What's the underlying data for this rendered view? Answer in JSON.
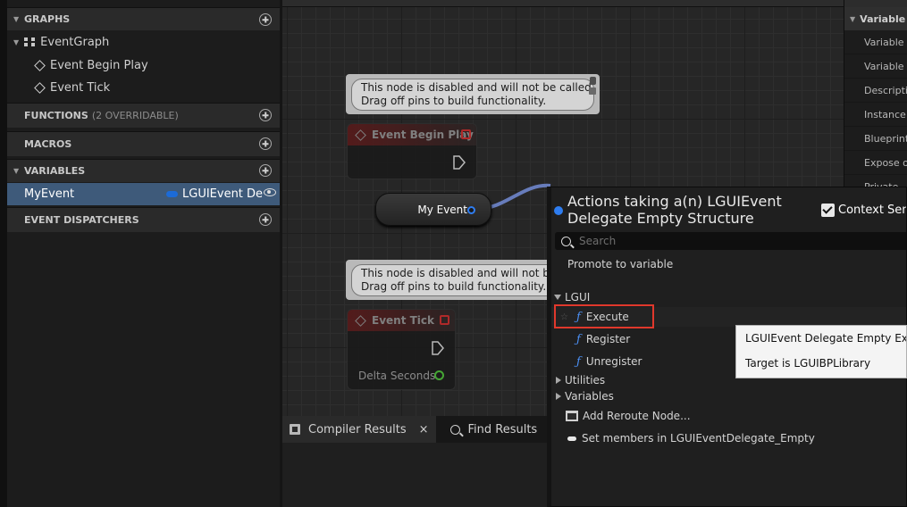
{
  "left_panel": {
    "graphs_header": "GRAPHS",
    "event_graph": "EventGraph",
    "event_begin_play": "Event Begin Play",
    "event_tick": "Event Tick",
    "functions_header": "FUNCTIONS",
    "functions_sub": "(2 OVERRIDABLE)",
    "macros_header": "MACROS",
    "variables_header": "VARIABLES",
    "variable": {
      "name": "MyEvent",
      "type": "LGUIEvent De"
    },
    "dispatchers_header": "EVENT DISPATCHERS"
  },
  "graph": {
    "comment_1": [
      "This node is disabled and will not be called.",
      "Drag off pins to build functionality."
    ],
    "comment_2": [
      "This node is disabled and will not be c",
      "Drag off pins to build functionality."
    ],
    "node_begin_play": "Event Begin Play",
    "node_tick": "Event Tick",
    "tick_pin": "Delta Seconds",
    "my_event_node": "My Event"
  },
  "details": {
    "section": "Variable",
    "rows": [
      "Variable N",
      "Variable T",
      "Descriptio",
      "Instance E",
      "Blueprint",
      "Expose or",
      "Private"
    ]
  },
  "bottom_tabs": {
    "compiler_results": "Compiler Results",
    "close": "×",
    "find_results": "Find Results"
  },
  "action_menu": {
    "title": "Actions taking a(n) LGUIEvent Delegate Empty Structure",
    "context_sensitive": "Context Sensi",
    "search_placeholder": "Search",
    "promote": "Promote to variable",
    "category_lgui": "LGUI",
    "execute": "Execute",
    "register": "Register",
    "unregister": "Unregister",
    "category_utilities": "Utilities",
    "category_variables": "Variables",
    "add_reroute": "Add Reroute Node...",
    "set_members": "Set members in LGUIEventDelegate_Empty"
  },
  "tooltip": {
    "line1": "LGUIEvent Delegate Empty Execut",
    "line2": "Target is LGUIBPLibrary"
  },
  "colors": {
    "selection": "#3e5a7a",
    "highlight_box": "#e0382c",
    "delegate_pin": "#2e7df0",
    "function_icon": "#4b8ff3"
  }
}
